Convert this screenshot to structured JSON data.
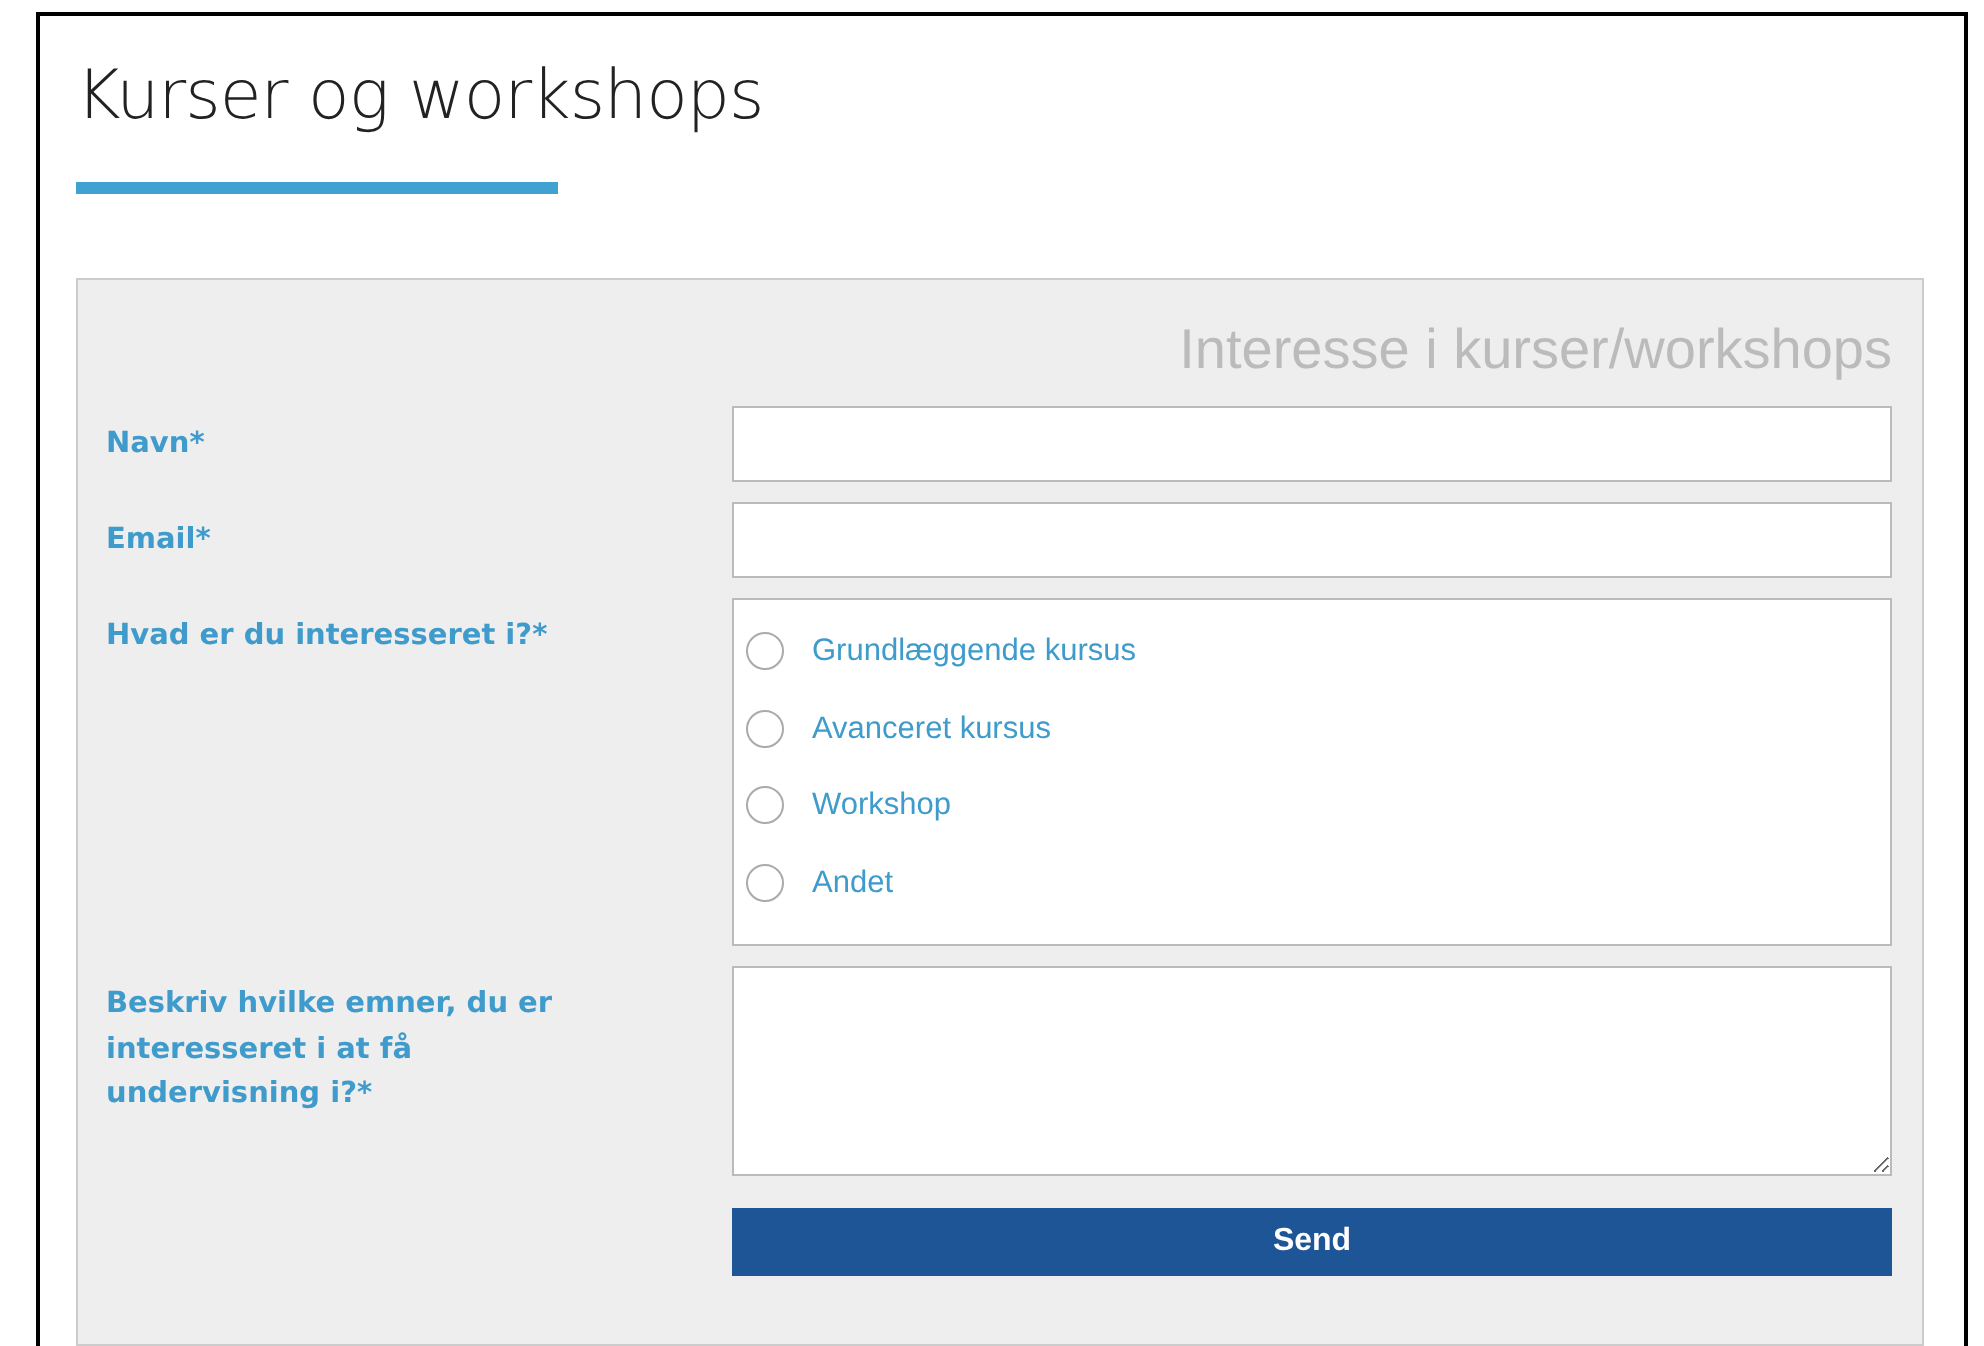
{
  "page": {
    "title": "Kurser og workshops"
  },
  "form": {
    "heading": "Interesse i kurser/workshops",
    "fields": [
      {
        "kind": "text",
        "label": "Navn*"
      },
      {
        "kind": "text",
        "label": "Email*"
      },
      {
        "kind": "radio",
        "label": "Hvad er du interesseret i?*",
        "options": [
          {
            "label": "Grundlæggende kursus",
            "selected": false
          },
          {
            "label": "Avanceret kursus",
            "selected": false
          },
          {
            "label": "Workshop",
            "selected": false
          },
          {
            "label": "Andet",
            "selected": false
          }
        ]
      },
      {
        "kind": "textarea",
        "label": "Beskriv hvilke emner, du er interesseret i at få undervisning i?*"
      }
    ],
    "submit": "Send"
  }
}
